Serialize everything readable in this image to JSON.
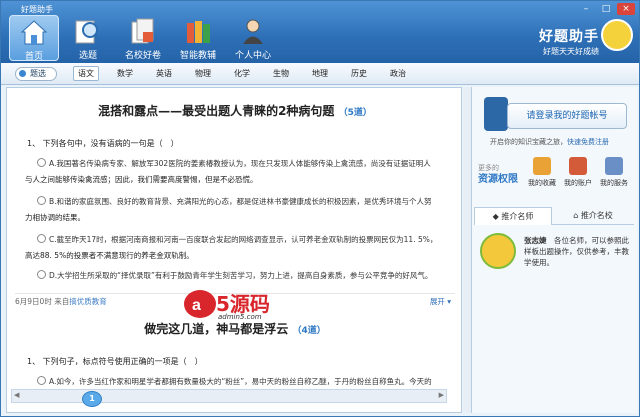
{
  "app": {
    "title": "好题助手"
  },
  "nav": [
    {
      "label": "首页"
    },
    {
      "label": "选题"
    },
    {
      "label": "名校好卷"
    },
    {
      "label": "智能教辅"
    },
    {
      "label": "个人中心"
    }
  ],
  "brand": {
    "name": "好题助手",
    "slogan": "好题天天好成绩"
  },
  "filter": {
    "label": "题选"
  },
  "subjects": [
    "语文",
    "数学",
    "英语",
    "物理",
    "化学",
    "生物",
    "地理",
    "历史",
    "政治"
  ],
  "article1": {
    "title": "混搭和露点——最受出题人青睐的2种病句题",
    "count": "5道",
    "question": "1、 下列各句中，没有语病的一句是（　）",
    "options": [
      "A.我国著名传染病专家、解放军302医院的姜素椿教授认为，现在只发现人体能够传染上禽流感，尚没有证据证明人",
      "与人之间能够传染禽流感；因此，我们需要高度警惕，但是不必恐慌。",
      "B.和谐的家庭氛围、良好的教育背景、充满阳光的心态，都是促进林书豪健康成长的积极因素，是优秀环境与个人努",
      "力相协调的结果。",
      "C.截至昨天17时，根据河南商报和河南一百度联合发起的网络调查显示，认可养老金双轨制的投票网民仅为11. 5%，",
      "高达88. 5%的投票者不满意现行的养老金双轨制。",
      "D.大学招生所采取的“择优录取”有利于鼓励青年学生刻苦学习，努力上进，提高自身素质，参与公平竞争的好风气。"
    ],
    "date": "6月9日0时",
    "source_prefix": "来自",
    "source": "搞优质教育",
    "expand": "展开"
  },
  "watermark": {
    "logo": "a5源码",
    "url": "admin5.com"
  },
  "article2": {
    "title": "做完这几道，神马都是浮云",
    "count": "4道",
    "question": "1、 下列句子，标点符号使用正确的一项是（　）",
    "option": "A.如今，许多当红作家和明星学者都拥有数量极大的“粉丝”，易中天的粉丝自称乙醚，于丹的粉丝自称鱼丸。今天的"
  },
  "pager": {
    "current": "1"
  },
  "sidebar": {
    "login": "请登录我的好题帐号",
    "note": "开启你的知识宝藏之旅，",
    "register": "快速免费注册",
    "more": "更多的",
    "rights": "资源权限",
    "icons": [
      {
        "label": "我的收藏"
      },
      {
        "label": "我的账户"
      },
      {
        "label": "我的服务"
      }
    ],
    "tabs": [
      "推介名师",
      "推介名校"
    ],
    "teacher": {
      "name": "张志婕",
      "desc": "各位名师，可以参照此样板出题操作，仅供参考，丰教学使用。"
    }
  },
  "colors": {
    "accent": "#2f78c4",
    "title_bar": "#2d6fb6"
  }
}
